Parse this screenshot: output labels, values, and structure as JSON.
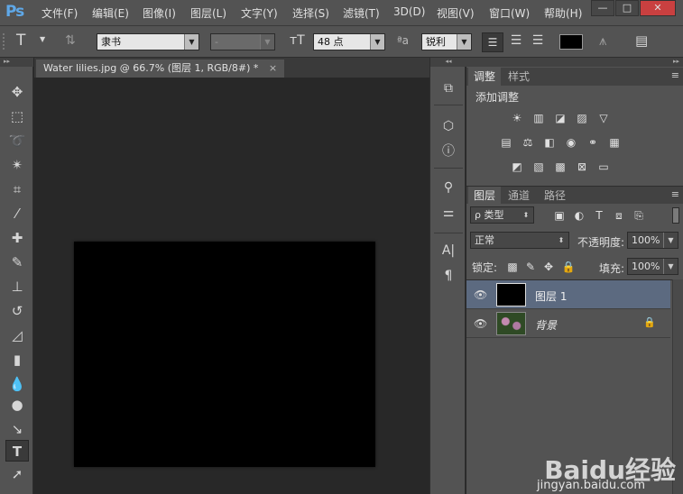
{
  "app": {
    "logo": "Ps"
  },
  "menu": [
    "文件(F)",
    "编辑(E)",
    "图像(I)",
    "图层(L)",
    "文字(Y)",
    "选择(S)",
    "滤镜(T)",
    "3D(D)",
    "视图(V)",
    "窗口(W)",
    "帮助(H)"
  ],
  "window_controls": {
    "minimize": "—",
    "restore": "□",
    "close": "✕"
  },
  "options": {
    "tool_glyph": "T",
    "font_family": "隶书",
    "font_style": "-",
    "font_size": "48 点",
    "aa_mode_icon": "ªa",
    "antialias": "锐利"
  },
  "document": {
    "tab_title": "Water lilies.jpg @ 66.7% (图层 1, RGB/8#) *",
    "tab_close": "×"
  },
  "adjustments": {
    "tabs": [
      "调整",
      "样式"
    ],
    "heading": "添加调整",
    "rows": [
      [
        "☀",
        "▥",
        "◪",
        "▨",
        "▽"
      ],
      [
        "▤",
        "⚖",
        "◧",
        "◉",
        "⚭",
        "▦"
      ],
      [
        "◩",
        "▧",
        "▩",
        "⊠",
        "▭"
      ]
    ]
  },
  "layers": {
    "tabs": [
      "图层",
      "通道",
      "路径"
    ],
    "filter_kind": "ρ 类型",
    "blend_mode": "正常",
    "opacity_label": "不透明度:",
    "opacity_value": "100%",
    "lock_label": "锁定:",
    "fill_label": "填充:",
    "fill_value": "100%",
    "items": [
      {
        "name": "图层 1",
        "selected": true,
        "locked": false
      },
      {
        "name": "背景",
        "selected": false,
        "locked": true
      }
    ]
  },
  "watermark": {
    "brand": "Baidu经验",
    "url": "jingyan.baidu.com"
  }
}
